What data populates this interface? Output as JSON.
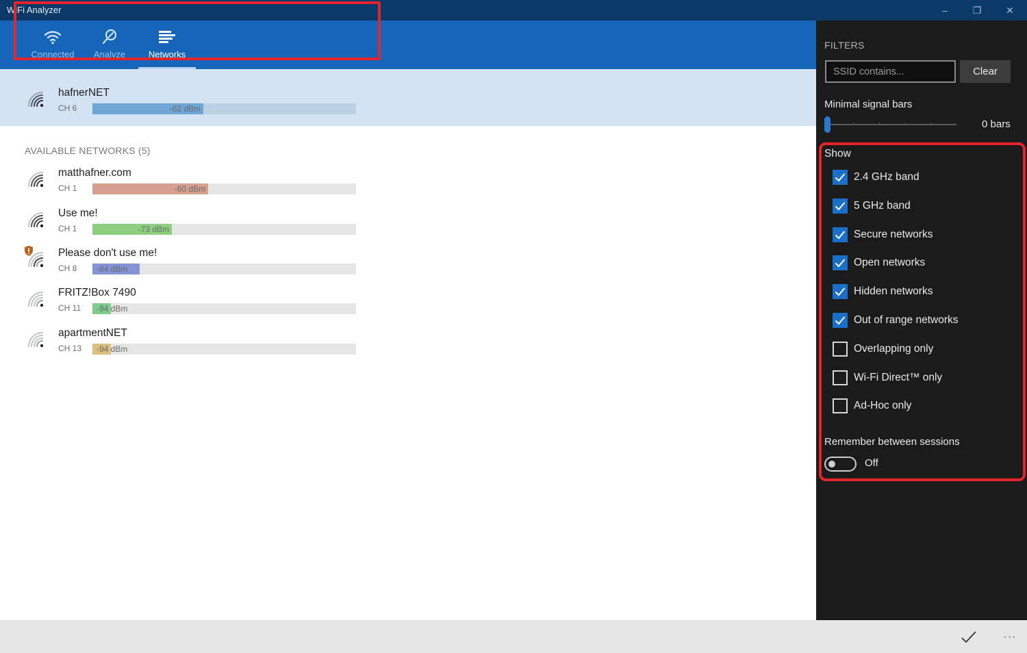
{
  "window": {
    "title": "WiFi Analyzer",
    "controls": {
      "minimize": "–",
      "maximize": "❐",
      "close": "✕"
    }
  },
  "nav": {
    "tabs": [
      {
        "label": "Connected",
        "icon": "wifi-icon",
        "active": false
      },
      {
        "label": "Analyze",
        "icon": "magnifier-icon",
        "active": false
      },
      {
        "label": "Networks",
        "icon": "list-icon",
        "active": true
      }
    ]
  },
  "connected_network": {
    "ssid": "hafnerNET",
    "channel": "CH 6",
    "signal": "-62 dBm",
    "signal_fraction": 0.42,
    "bar_color": "#6ea6d6",
    "icon": "wifi-signal-icon"
  },
  "available": {
    "header": "AVAILABLE NETWORKS (5)",
    "networks": [
      {
        "ssid": "matthafner.com",
        "channel": "CH 1",
        "signal": "-60 dBm",
        "signal_fraction": 0.44,
        "bar_color": "#d4a090",
        "secured_warning": false
      },
      {
        "ssid": "Use me!",
        "channel": "CH 1",
        "signal": "-73 dBm",
        "signal_fraction": 0.3,
        "bar_color": "#8ccf7e",
        "secured_warning": false
      },
      {
        "ssid": "Please don't use me!",
        "channel": "CH 8",
        "signal": "-84 dBm",
        "signal_fraction": 0.18,
        "bar_color": "#8293d6",
        "secured_warning": true
      },
      {
        "ssid": "FRITZ!Box 7490",
        "channel": "CH 11",
        "signal": "-94 dBm",
        "signal_fraction": 0.07,
        "bar_color": "#7fcc8f",
        "secured_warning": false
      },
      {
        "ssid": "apartmentNET",
        "channel": "CH 13",
        "signal": "-94 dBm",
        "signal_fraction": 0.07,
        "bar_color": "#dcc081",
        "secured_warning": false
      }
    ]
  },
  "filters": {
    "heading": "FILTERS",
    "ssid_placeholder": "SSID contains...",
    "ssid_value": "",
    "clear_label": "Clear",
    "min_bars_label": "Minimal signal bars",
    "min_bars_value": 0,
    "min_bars_text": "0 bars",
    "show_label": "Show",
    "options": [
      {
        "label": "2.4 GHz band",
        "checked": true
      },
      {
        "label": "5 GHz band",
        "checked": true
      },
      {
        "label": "Secure networks",
        "checked": true
      },
      {
        "label": "Open networks",
        "checked": true
      },
      {
        "label": "Hidden networks",
        "checked": true
      },
      {
        "label": "Out of range networks",
        "checked": true
      },
      {
        "label": "Overlapping only",
        "checked": false
      },
      {
        "label": "Wi-Fi Direct™ only",
        "checked": false
      },
      {
        "label": "Ad-Hoc only",
        "checked": false
      }
    ],
    "remember_label": "Remember between sessions",
    "remember_state": "Off",
    "remember_on": false
  },
  "appbar": {
    "accept_icon": "checkmark-icon",
    "more_label": "···"
  },
  "colors": {
    "titlebar": "#0b3a68",
    "navbar": "#1565b8",
    "accent": "#1a6fc9",
    "highlight": "#e3242b",
    "pane": "#1b1b1b"
  }
}
